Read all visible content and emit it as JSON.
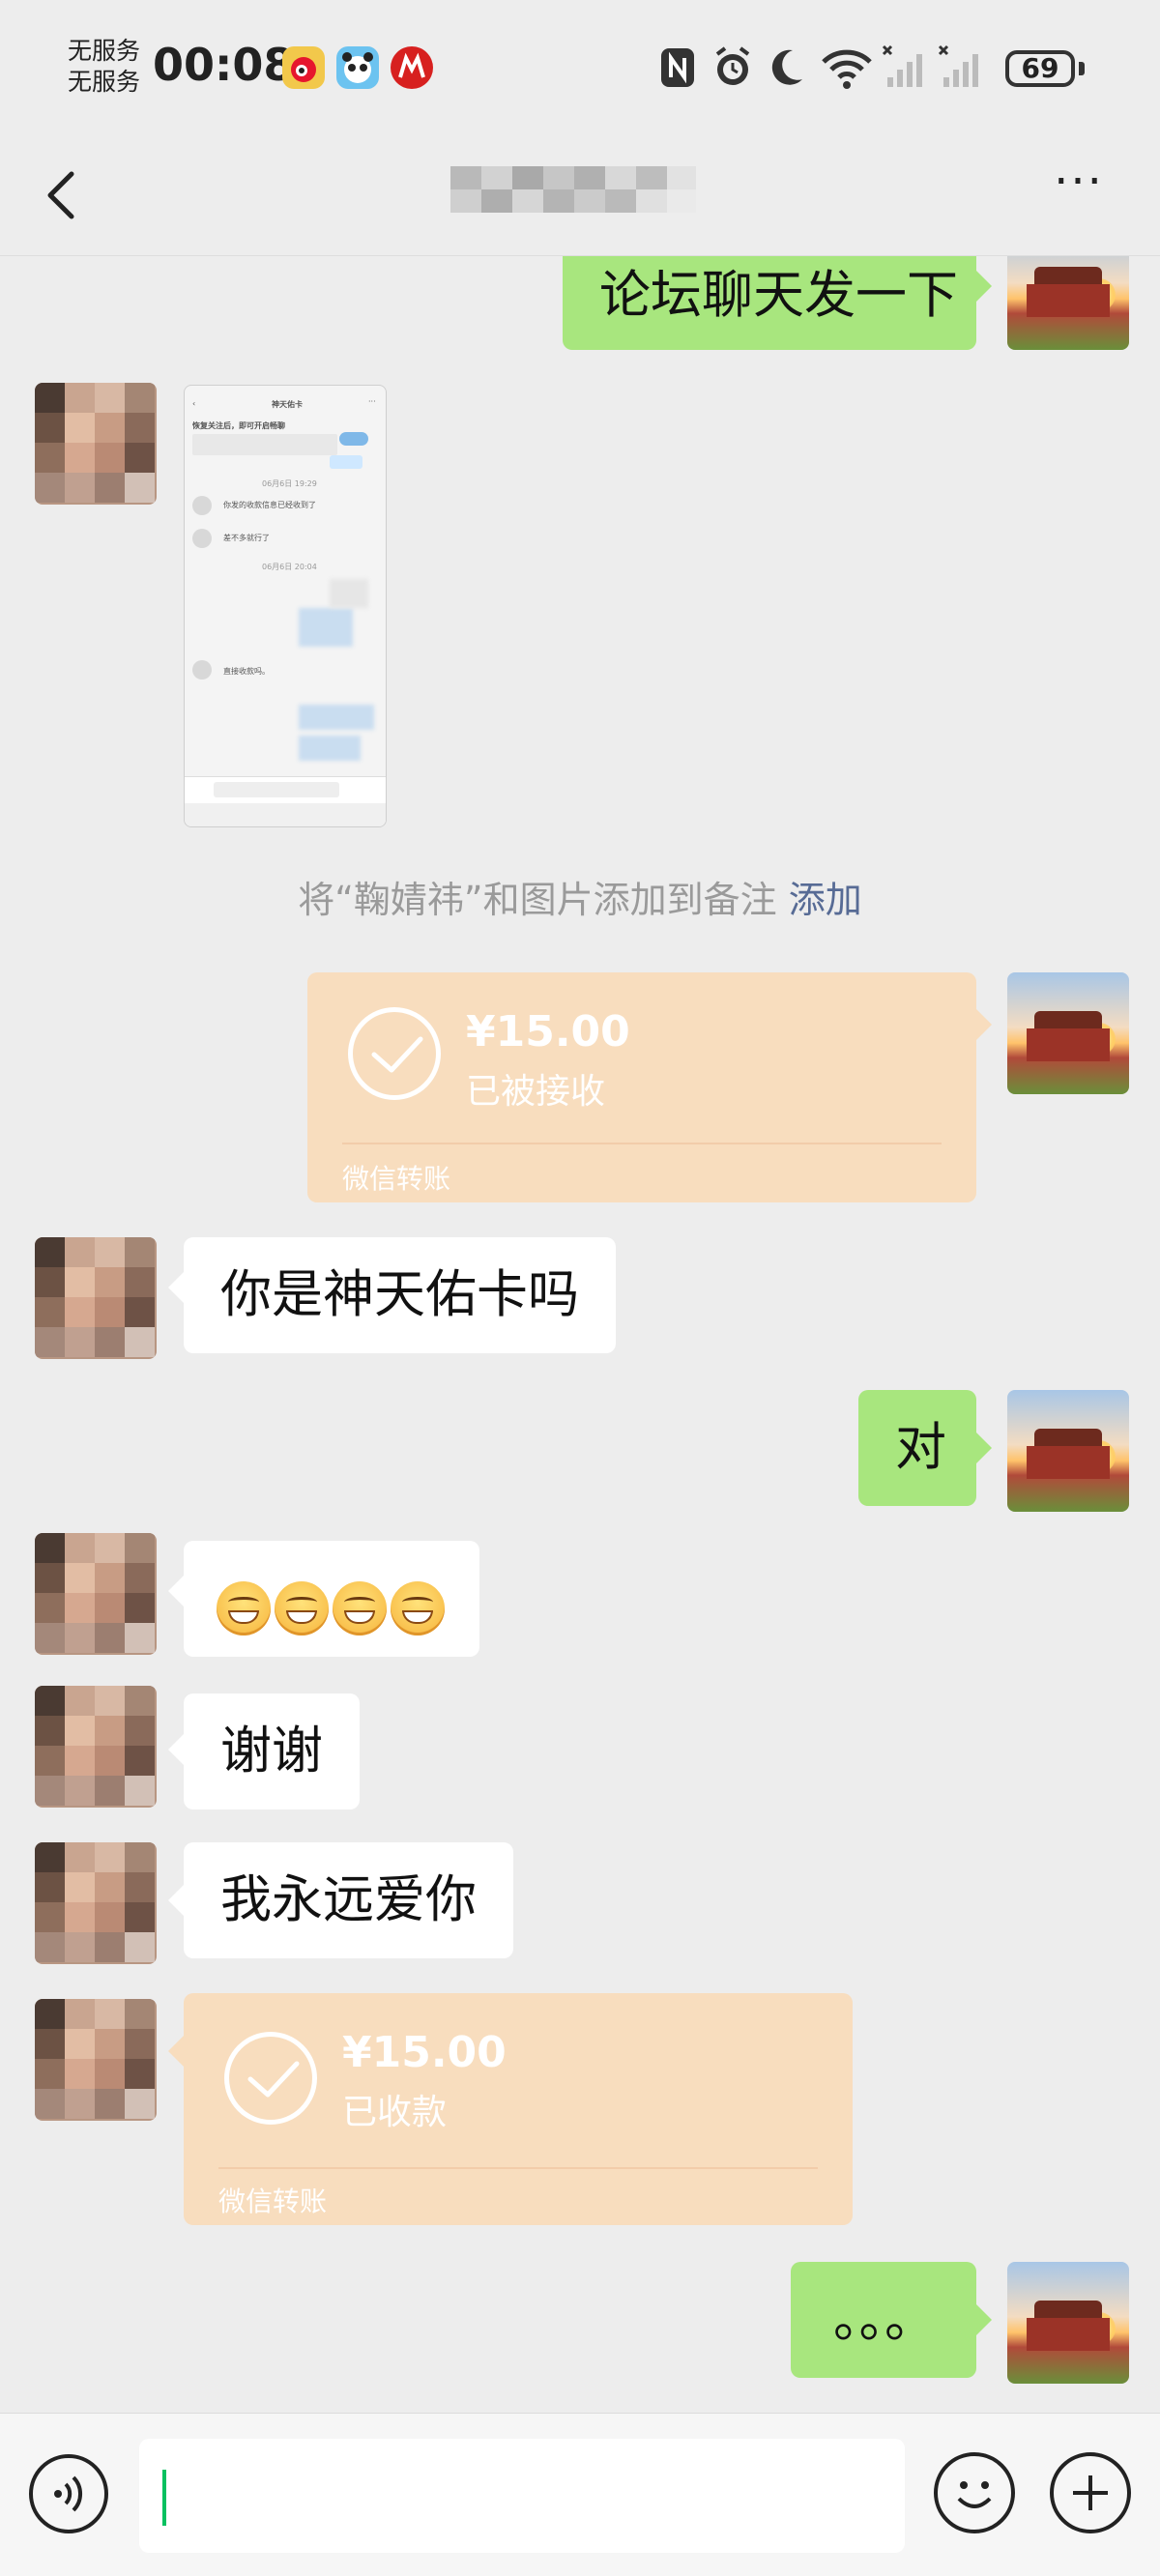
{
  "status_bar": {
    "carrier_1": "无服务",
    "carrier_2": "无服务",
    "time": "00:08",
    "battery": "69"
  },
  "nav": {
    "back_icon": "chevron-left-icon",
    "more_label": "···"
  },
  "thumbnail": {
    "title": "神天佑卡",
    "line_1": "恢复关注后，即可开启畅聊",
    "line_2": "你发的收款信息已经收到了",
    "line_3": "差不多就行了",
    "line_4": "直接收款吗。",
    "time_1": "06月6日 19:29",
    "time_2": "06月6日 20:04",
    "follow_label": "关注"
  },
  "messages": [
    {
      "type": "text",
      "side": "out",
      "text": "论坛聊天发一下"
    },
    {
      "type": "image",
      "side": "in"
    },
    {
      "type": "system",
      "prefix": "将“鞠婧祎”和图片添加到备注",
      "link": "添加"
    },
    {
      "type": "transfer",
      "side": "out",
      "amount": "¥15.00",
      "status": "已被接收",
      "brand": "微信转账"
    },
    {
      "type": "text",
      "side": "in",
      "text": "你是神天佑卡吗"
    },
    {
      "type": "text",
      "side": "out",
      "text": "对"
    },
    {
      "type": "emoji",
      "side": "in",
      "emoji": "grin",
      "count": 4
    },
    {
      "type": "text",
      "side": "in",
      "text": "谢谢"
    },
    {
      "type": "text",
      "side": "in",
      "text": "我永远爱你"
    },
    {
      "type": "transfer",
      "side": "in",
      "amount": "¥15.00",
      "status": "已收款",
      "brand": "微信转账"
    },
    {
      "type": "text",
      "side": "out",
      "text": "。。。"
    }
  ],
  "input_bar": {
    "voice_icon": "voice-icon",
    "input_value": "",
    "emoji_icon": "smiley-icon",
    "plus_icon": "plus-icon"
  },
  "colors": {
    "background": "#ededed",
    "outgoing_bubble": "#a8e67e",
    "incoming_bubble": "#ffffff",
    "transfer_card": "#f8ddbe",
    "link": "#576b95",
    "caret": "#07c160"
  }
}
